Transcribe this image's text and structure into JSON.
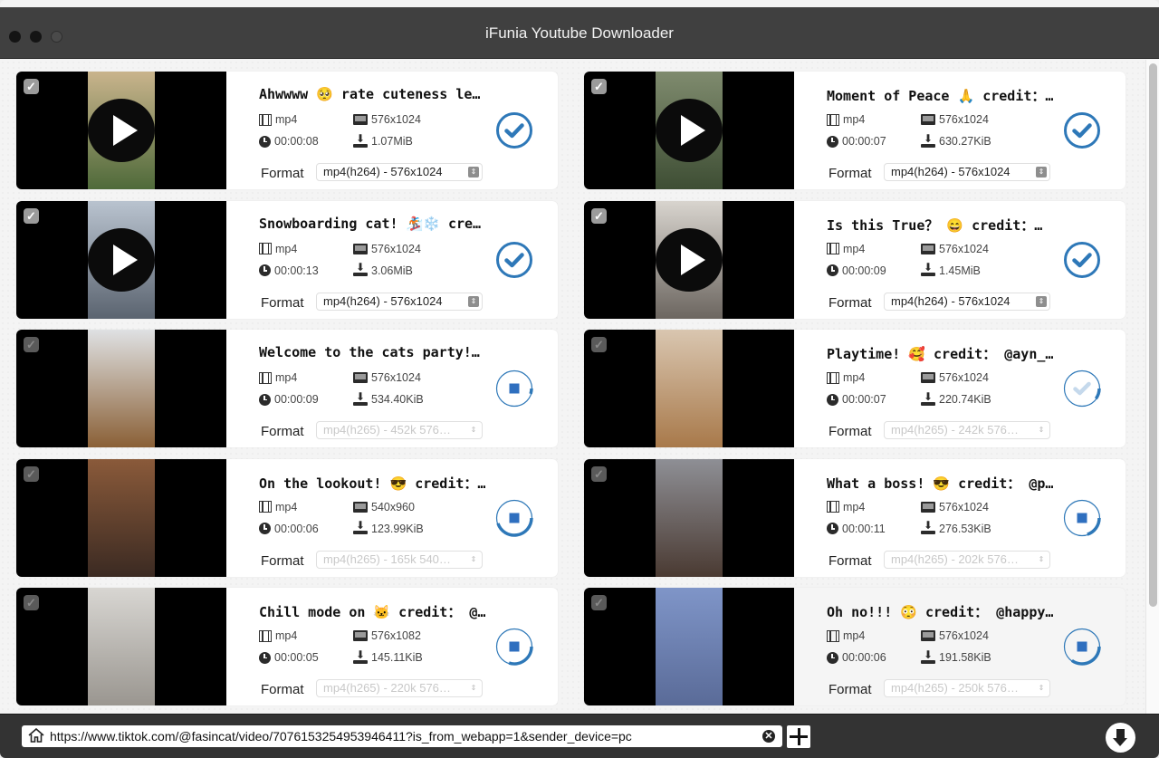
{
  "window": {
    "title": "iFunia Youtube Downloader"
  },
  "colors": {
    "accent": "#2e78b8",
    "stop_square": "#2f6fbf",
    "titlebar": "#404040",
    "bottombar": "#333333"
  },
  "format_label": "Format",
  "videos": [
    {
      "title": "Ahwwww 🥺 rate cuteness le…",
      "container": "mp4",
      "resolution": "576x1024",
      "duration": "00:00:08",
      "size": "1.07MiB",
      "format": "mp4(h264) -  576x1024",
      "format_enabled": true,
      "checked": true,
      "status": "done",
      "progress": 1.0,
      "thumb_colors": [
        "#c9b48c",
        "#4f6a3a"
      ]
    },
    {
      "title": "Moment of Peace 🙏 credit：…",
      "container": "mp4",
      "resolution": "576x1024",
      "duration": "00:00:07",
      "size": "630.27KiB",
      "format": "mp4(h264) -  576x1024",
      "format_enabled": true,
      "checked": true,
      "status": "done",
      "progress": 1.0,
      "thumb_colors": [
        "#7f8b6e",
        "#3e4e34"
      ]
    },
    {
      "title": "Snowboarding cat! 🏂❄️ cre…",
      "container": "mp4",
      "resolution": "576x1024",
      "duration": "00:00:13",
      "size": "3.06MiB",
      "format": "mp4(h264) -  576x1024",
      "format_enabled": true,
      "checked": true,
      "status": "done",
      "progress": 1.0,
      "thumb_colors": [
        "#b9c3cf",
        "#5b6470"
      ]
    },
    {
      "title": "Is this True？ 😄 credit：…",
      "container": "mp4",
      "resolution": "576x1024",
      "duration": "00:00:09",
      "size": "1.45MiB",
      "format": "mp4(h264) -  576x1024",
      "format_enabled": true,
      "checked": true,
      "status": "done",
      "progress": 1.0,
      "thumb_colors": [
        "#d8d4ce",
        "#6c6660"
      ]
    },
    {
      "title": "Welcome to the cats party!…",
      "container": "mp4",
      "resolution": "576x1024",
      "duration": "00:00:09",
      "size": "534.40KiB",
      "format": "mp4(h265) - 452k 576…",
      "format_enabled": false,
      "checked": true,
      "status": "downloading",
      "progress": 0.05,
      "thumb_colors": [
        "#dfe1e3",
        "#8a6036"
      ]
    },
    {
      "title": "Playtime! 🥰 credit： @ayn_…",
      "container": "mp4",
      "resolution": "576x1024",
      "duration": "00:00:07",
      "size": "220.74KiB",
      "format": "mp4(h265) - 242k 576…",
      "format_enabled": false,
      "checked": true,
      "status": "finishing",
      "progress": 0.1,
      "thumb_colors": [
        "#d9c6b0",
        "#a8794a"
      ]
    },
    {
      "title": "On the lookout! 😎 credit：…",
      "container": "mp4",
      "resolution": "540x960",
      "duration": "00:00:06",
      "size": "123.99KiB",
      "format": "mp4(h265) - 165k 540…",
      "format_enabled": false,
      "checked": true,
      "status": "downloading",
      "progress": 0.45,
      "thumb_colors": [
        "#8a5a3a",
        "#3b2a22"
      ]
    },
    {
      "title": "What a boss! 😎 credit： @p…",
      "container": "mp4",
      "resolution": "576x1024",
      "duration": "00:00:11",
      "size": "276.53KiB",
      "format": "mp4(h265) - 202k 576…",
      "format_enabled": false,
      "checked": true,
      "status": "downloading",
      "progress": 0.2,
      "thumb_colors": [
        "#8e8f95",
        "#4a3a32"
      ]
    },
    {
      "title": "Chill mode on 🐱 credit： @…",
      "container": "mp4",
      "resolution": "576x1082",
      "duration": "00:00:05",
      "size": "145.11KiB",
      "format": "mp4(h265) - 220k 576…",
      "format_enabled": false,
      "checked": true,
      "status": "downloading",
      "progress": 0.3,
      "thumb_colors": [
        "#d8d6d2",
        "#9a9690"
      ]
    },
    {
      "title": "Oh no!!! 😳 credit： @happy…",
      "container": "mp4",
      "resolution": "576x1024",
      "duration": "00:00:06",
      "size": "191.58KiB",
      "format": "mp4(h265) - 250k 576…",
      "format_enabled": false,
      "checked": true,
      "status": "downloading",
      "progress": 0.35,
      "thumb_colors": [
        "#7f95c8",
        "#5a6b98"
      ]
    }
  ],
  "bottombar": {
    "url_value": "https://www.tiktok.com/@fasincat/video/7076153254953946411?is_from_webapp=1&sender_device=pc",
    "url_placeholder": "",
    "clear_glyph": "✕"
  },
  "icons": {
    "film": "film-icon",
    "clock": "clock-icon",
    "screen": "monitor-icon",
    "download": "download-icon",
    "home": "home-icon",
    "add": "plus-icon",
    "download_all": "download-arrow-icon",
    "checkbox_glyph": "✓",
    "select_arrow_glyph": "⇕"
  }
}
